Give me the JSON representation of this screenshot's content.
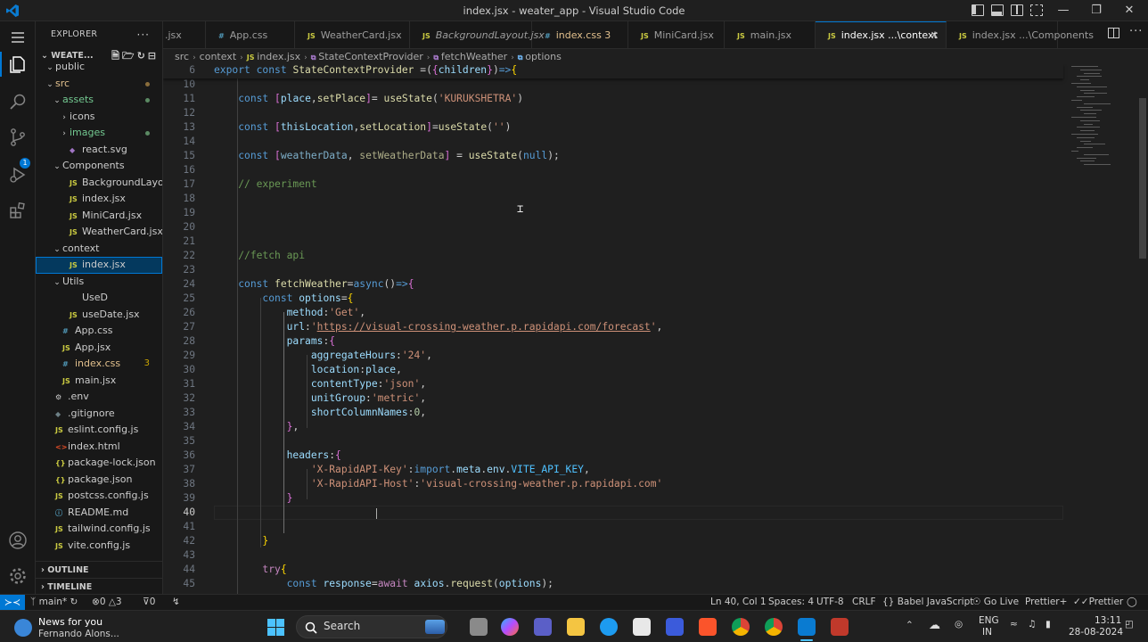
{
  "window": {
    "title": "index.jsx - weater_app - Visual Studio Code"
  },
  "sidebar": {
    "header": "EXPLORER",
    "root_label": "WEATE...",
    "items": [
      {
        "label": "public",
        "type": "folder",
        "depth": 1,
        "open": true
      },
      {
        "label": "src",
        "type": "folder",
        "depth": 1,
        "open": true,
        "color": "#e2c08d",
        "dot": true
      },
      {
        "label": "assets",
        "type": "folder",
        "depth": 2,
        "open": true,
        "color": "#73c991",
        "dot": true
      },
      {
        "label": "icons",
        "type": "folder",
        "depth": 3,
        "open": false
      },
      {
        "label": "images",
        "type": "folder",
        "depth": 3,
        "open": false,
        "color": "#73c991",
        "dot": true
      },
      {
        "label": "react.svg",
        "type": "svg",
        "depth": 3
      },
      {
        "label": "Components",
        "type": "folder",
        "depth": 2,
        "open": true
      },
      {
        "label": "BackgroundLayout...",
        "type": "js",
        "depth": 3
      },
      {
        "label": "index.jsx",
        "type": "js",
        "depth": 3
      },
      {
        "label": "MiniCard.jsx",
        "type": "js",
        "depth": 3
      },
      {
        "label": "WeatherCard.jsx",
        "type": "js",
        "depth": 3
      },
      {
        "label": "context",
        "type": "folder",
        "depth": 2,
        "open": true
      },
      {
        "label": "index.jsx",
        "type": "js",
        "depth": 3,
        "selected": true
      },
      {
        "label": "Utils",
        "type": "folder",
        "depth": 2,
        "open": true
      },
      {
        "label": "UseD",
        "type": "plain",
        "depth": 3
      },
      {
        "label": "useDate.jsx",
        "type": "js",
        "depth": 3
      },
      {
        "label": "App.css",
        "type": "css",
        "depth": 2
      },
      {
        "label": "App.jsx",
        "type": "js",
        "depth": 2
      },
      {
        "label": "index.css",
        "type": "css",
        "depth": 2,
        "color": "#e2c08d",
        "count": "3"
      },
      {
        "label": "main.jsx",
        "type": "js",
        "depth": 2
      },
      {
        "label": ".env",
        "type": "gear",
        "depth": 1
      },
      {
        "label": ".gitignore",
        "type": "git",
        "depth": 1
      },
      {
        "label": "eslint.config.js",
        "type": "js",
        "depth": 1
      },
      {
        "label": "index.html",
        "type": "html",
        "depth": 1
      },
      {
        "label": "package-lock.json",
        "type": "json",
        "depth": 1
      },
      {
        "label": "package.json",
        "type": "json",
        "depth": 1
      },
      {
        "label": "postcss.config.js",
        "type": "js",
        "depth": 1
      },
      {
        "label": "README.md",
        "type": "info",
        "depth": 1
      },
      {
        "label": "tailwind.config.js",
        "type": "js",
        "depth": 1
      },
      {
        "label": "vite.config.js",
        "type": "js",
        "depth": 1
      }
    ],
    "outline": "OUTLINE",
    "timeline": "TIMELINE"
  },
  "tabs": [
    {
      "label": ".jsx",
      "icon": ""
    },
    {
      "label": "App.css",
      "icon": "#"
    },
    {
      "label": "WeatherCard.jsx",
      "icon": "JS"
    },
    {
      "label": "BackgroundLayout.jsx",
      "icon": "JS",
      "italic": true
    },
    {
      "label": "index.css 3",
      "icon": "#",
      "color": "#e2c08d"
    },
    {
      "label": "MiniCard.jsx",
      "icon": "JS"
    },
    {
      "label": "main.jsx",
      "icon": "JS"
    },
    {
      "label": "index.jsx ...\\context",
      "icon": "JS",
      "active": true
    },
    {
      "label": "index.jsx ...\\Components",
      "icon": "JS"
    }
  ],
  "breadcrumb": [
    "src",
    "context",
    "index.jsx",
    "StateContextProvider",
    "fetchWeather",
    "options"
  ],
  "editor": {
    "sticky_line_number": "6",
    "current_line": "40",
    "line_numbers": [
      "10",
      "11",
      "12",
      "13",
      "14",
      "15",
      "16",
      "17",
      "18",
      "19",
      "20",
      "21",
      "22",
      "23",
      "24",
      "25",
      "26",
      "27",
      "28",
      "29",
      "30",
      "31",
      "32",
      "33",
      "34",
      "35",
      "36",
      "37",
      "38",
      "39",
      "40",
      "41",
      "42",
      "43",
      "44",
      "45"
    ]
  },
  "statusbar": {
    "branch": "main*",
    "problems": "0",
    "warnings": "3",
    "ports": "0",
    "position": "Ln 40, Col 1",
    "spaces": "Spaces: 4",
    "encoding": "UTF-8",
    "eol": "CRLF",
    "language": "Babel JavaScript",
    "golive": "Go Live",
    "prettier_plus": "Prettier+",
    "prettier": "Prettier"
  },
  "taskbar": {
    "news_title": "News for you",
    "news_sub": "Fernando Alons...",
    "search_label": "Search",
    "lang_top": "ENG",
    "lang_bottom": "IN",
    "time": "13:11",
    "date": "28-08-2024"
  },
  "colors": {
    "accent": "#0078d4",
    "editor_bg": "#1f1f1f",
    "sidebar_bg": "#181818",
    "keyword": "#569cd6",
    "string": "#ce9178",
    "function": "#dcdcaa",
    "variable": "#9cdcfe",
    "comment": "#6a9955"
  }
}
